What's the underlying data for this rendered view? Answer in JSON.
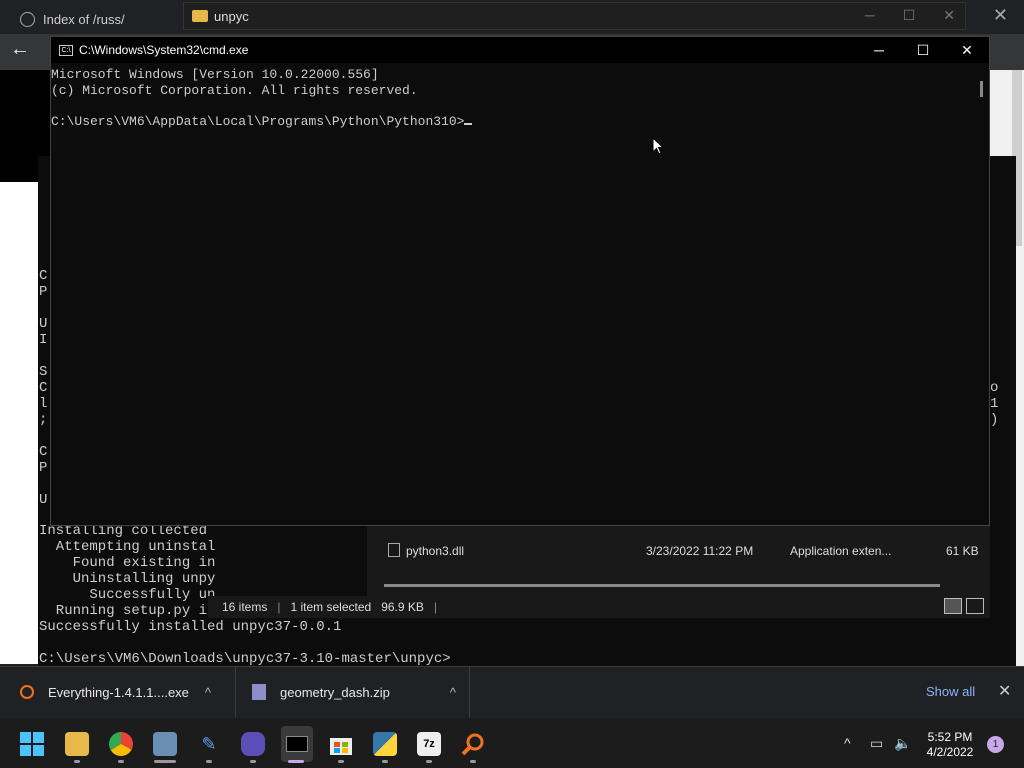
{
  "browser": {
    "tab_title": "Index of /russ/",
    "close": "✕",
    "back": "←"
  },
  "explorer": {
    "title": "unpyc",
    "file": {
      "name": "python3.dll",
      "date": "3/23/2022 11:22 PM",
      "type": "Application exten...",
      "size": "61 KB"
    },
    "status": {
      "items": "16 items",
      "selected": "1 item selected",
      "size": "96.9 KB"
    }
  },
  "bg_terminal": {
    "left_fragments": [
      "C",
      "P",
      "",
      "U",
      "I",
      "",
      "S",
      "C",
      "l",
      ";",
      "",
      "C",
      "P",
      "",
      "U"
    ],
    "right_fragments": [
      "o",
      "1",
      ")"
    ],
    "lines": [
      "Installing collected",
      "  Attempting uninstal",
      "    Found existing in",
      "    Uninstalling unpy",
      "      Successfully un",
      "  Running setup.py in",
      "Successfully installed unpyc37-0.0.1",
      "",
      "C:\\Users\\VM6\\Downloads\\unpyc37-3.10-master\\unpyc>"
    ]
  },
  "cmd": {
    "title": "C:\\Windows\\System32\\cmd.exe",
    "icon_text": "C:\\",
    "lines": [
      "Microsoft Windows [Version 10.0.22000.556]",
      "(c) Microsoft Corporation. All rights reserved.",
      "",
      "C:\\Users\\VM6\\AppData\\Local\\Programs\\Python\\Python310>"
    ],
    "minimize": "─",
    "maximize": "☐",
    "close": "✕"
  },
  "downloads": {
    "items": [
      {
        "name": "Everything-1.4.1.1....exe"
      },
      {
        "name": "geometry_dash.zip"
      }
    ],
    "chevron": "^",
    "show_all": "Show all",
    "close": "✕"
  },
  "taskbar": {
    "icons": [
      "start-icon",
      "file-explorer-icon",
      "chrome-icon",
      "control-panel-icon",
      "pen-icon",
      "vr-icon",
      "terminal-icon",
      "store-icon",
      "python-icon",
      "7zip-icon",
      "everything-search-icon"
    ],
    "icon_text": {
      "sevenzip": "7z"
    },
    "time": "5:52 PM",
    "date": "4/2/2022",
    "notification_count": "1",
    "tray_chevron": "^"
  }
}
